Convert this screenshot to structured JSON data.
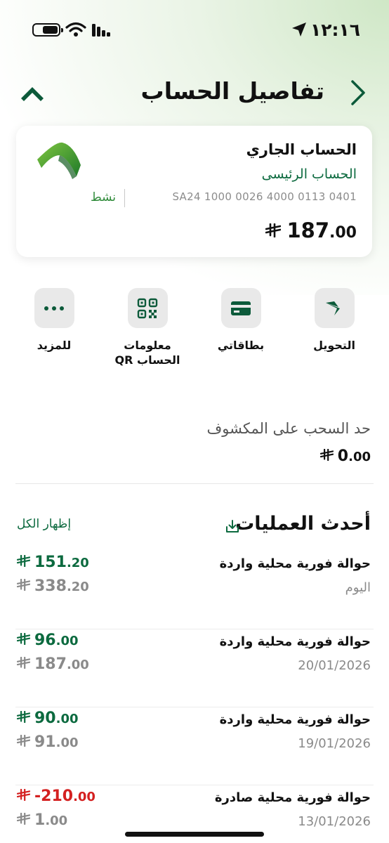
{
  "status_bar": {
    "time": "١٢:١٦"
  },
  "header": {
    "title": "تفاصيل الحساب"
  },
  "account": {
    "type": "الحساب الجاري",
    "name": "الحساب الرئيسى",
    "iban": "SA24 1000 0026 4000 0113 0401",
    "status": "نشط",
    "balance_int": "187",
    "balance_dec": ".00"
  },
  "actions": [
    {
      "label": "التحويل",
      "icon": "transfer-icon"
    },
    {
      "label": "بطاقاتي",
      "icon": "card-icon"
    },
    {
      "label": "معلومات",
      "label2": "الحساب QR",
      "icon": "qr-icon"
    },
    {
      "label": "للمزيد",
      "icon": "more-icon"
    }
  ],
  "overdraft": {
    "label": "حد السحب على المكشوف",
    "value_int": "0",
    "value_dec": ".00"
  },
  "transactions_section": {
    "title": "أحدث العمليات",
    "show_all": "إظهار الكل"
  },
  "transactions": [
    {
      "desc": "حوالة فورية محلية واردة",
      "date": "اليوم",
      "amount_int": "151",
      "amount_dec": ".20",
      "balance_int": "338",
      "balance_dec": ".20",
      "direction": "in"
    },
    {
      "desc": "حوالة فورية محلية واردة",
      "date": "20/01/2026",
      "amount_int": "96",
      "amount_dec": ".00",
      "balance_int": "187",
      "balance_dec": ".00",
      "direction": "in"
    },
    {
      "desc": "حوالة فورية محلية واردة",
      "date": "19/01/2026",
      "amount_int": "90",
      "amount_dec": ".00",
      "balance_int": "91",
      "balance_dec": ".00",
      "direction": "in"
    },
    {
      "desc": "حوالة فورية محلية صادرة",
      "date": "13/01/2026",
      "amount_int": "-210",
      "amount_dec": ".00",
      "balance_int": "1",
      "balance_dec": ".00",
      "direction": "out"
    }
  ],
  "colors": {
    "brand_green": "#0c6a3f",
    "incoming": "#0c6a3f",
    "outgoing": "#d42020",
    "muted": "#8a8a8a"
  }
}
